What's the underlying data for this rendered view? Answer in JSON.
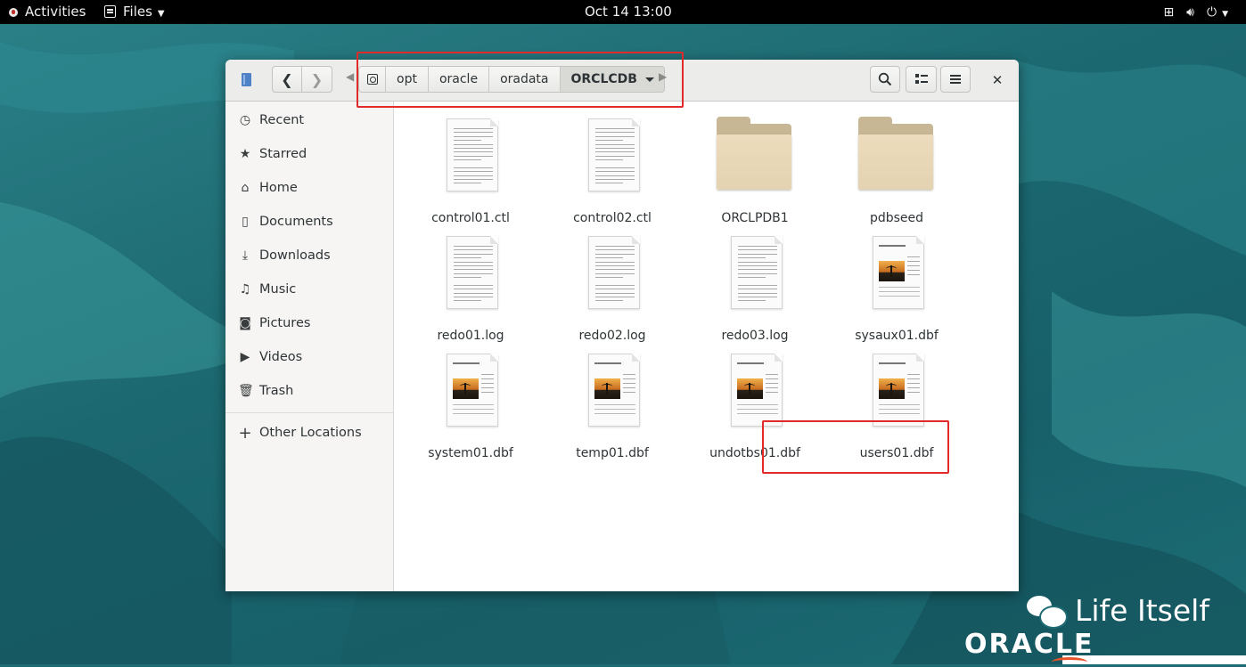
{
  "topbar": {
    "activities": "Activities",
    "app_menu": "Files",
    "clock": "Oct 14  13:00",
    "status_icons": [
      "network-icon",
      "volume-icon",
      "power-icon"
    ]
  },
  "headerbar": {
    "breadcrumbs": [
      "opt",
      "oracle",
      "oradata"
    ],
    "current_folder": "ORCLCDB"
  },
  "sidebar": {
    "items": [
      {
        "label": "Recent",
        "icon": "clock-icon"
      },
      {
        "label": "Starred",
        "icon": "star-icon"
      },
      {
        "label": "Home",
        "icon": "home-icon"
      },
      {
        "label": "Documents",
        "icon": "document-icon"
      },
      {
        "label": "Downloads",
        "icon": "download-icon"
      },
      {
        "label": "Music",
        "icon": "music-icon"
      },
      {
        "label": "Pictures",
        "icon": "camera-icon"
      },
      {
        "label": "Videos",
        "icon": "video-icon"
      },
      {
        "label": "Trash",
        "icon": "trash-icon"
      }
    ],
    "other_locations": "Other Locations"
  },
  "files": [
    {
      "name": "control01.ctl",
      "type": "text"
    },
    {
      "name": "control02.ctl",
      "type": "text"
    },
    {
      "name": "ORCLPDB1",
      "type": "folder"
    },
    {
      "name": "pdbseed",
      "type": "folder"
    },
    {
      "name": "redo01.log",
      "type": "text"
    },
    {
      "name": "redo02.log",
      "type": "text"
    },
    {
      "name": "redo03.log",
      "type": "text"
    },
    {
      "name": "sysaux01.dbf",
      "type": "document"
    },
    {
      "name": "system01.dbf",
      "type": "document"
    },
    {
      "name": "temp01.dbf",
      "type": "document"
    },
    {
      "name": "undotbs01.dbf",
      "type": "document"
    },
    {
      "name": "users01.dbf",
      "type": "document"
    }
  ],
  "watermark": {
    "text": "Life Itself",
    "brand": "ORACLE"
  },
  "colors": {
    "highlight": "#e22a2a",
    "wallpaper": "#1f6b73"
  }
}
